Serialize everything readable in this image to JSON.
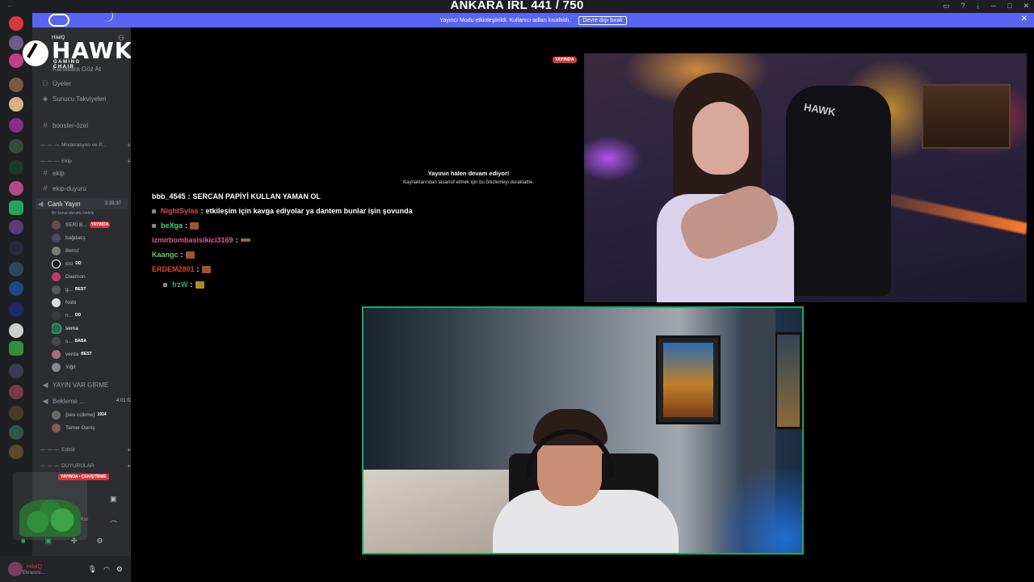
{
  "window": {
    "title": "ANKARA IRL 441 / 750"
  },
  "notice": {
    "text": "Yayıncı Modu etkinleştirildi. Kullanıcı adları kısaltıldı.",
    "button": "Devre dışı bırak"
  },
  "brand": {
    "word": "HAWK",
    "sub": "GAMING CHAIR"
  },
  "sidebar": {
    "server_name": "HilalQ",
    "items": [
      {
        "label": "Kanallara Göz At"
      },
      {
        "label": "Üyeler"
      },
      {
        "label": "Sunucu Takviyeleri"
      },
      {
        "label": "booster-özel"
      },
      {
        "label": "Moderasyon ve P..."
      },
      {
        "label": "Ekip"
      },
      {
        "label": "ekip"
      },
      {
        "label": "ekip-duyuru"
      },
      {
        "label": "Canlı Yayın"
      },
      {
        "label": "Bir kanal durumu belirle"
      },
      {
        "label": "YAYIN VAR GİRME"
      },
      {
        "label": "Bekleme ..."
      },
      {
        "label": "Editör"
      },
      {
        "label": "DUYURULAR"
      }
    ],
    "live_time": "3:35:37",
    "wait_time": "4:01:03",
    "live_badge": "YAYINDA",
    "voice_users": [
      {
        "name": "SERİ B...",
        "tag": "YAYINDA"
      },
      {
        "name": "bağdacş",
        "tag": ""
      },
      {
        "name": "Berru'",
        "tag": ""
      },
      {
        "name": "cici",
        "tag": "DD"
      },
      {
        "name": "Daemon",
        "tag": ""
      },
      {
        "name": "g...",
        "tag": "BEST"
      },
      {
        "name": "Nobi",
        "tag": ""
      },
      {
        "name": "n...",
        "tag": "DD"
      },
      {
        "name": "sema",
        "tag": ""
      },
      {
        "name": "s...",
        "tag": "BABA"
      },
      {
        "name": "verda",
        "tag": "BEST"
      },
      {
        "name": "Yiğit",
        "tag": ""
      }
    ],
    "wait_users": [
      {
        "name": "{ses ccikme}",
        "tag": "1934"
      },
      {
        "name": "Tamer Daniş",
        "tag": ""
      }
    ]
  },
  "voice_panel": {
    "badge": "YAYINDA • ÇEKİŞTİRME",
    "kur": "Kur"
  },
  "user_panel": {
    "name": "HilalQ",
    "status": "Ekranını..."
  },
  "stream": {
    "live_pill": "YAYINDA",
    "paused_title": "Yayının halen devam ediyor!",
    "paused_sub": "Kaynaklarından tasarruf etmek için bu önizlemeyi duraklattık.",
    "cam_brand": "HAWK"
  },
  "chat": [
    {
      "user": "bbb_4545",
      "sep": " : ",
      "text": "SERCAN PAPİYİ KULLAN YAMAN OL",
      "color": "#ffffff"
    },
    {
      "user": "NightSylas",
      "sep": " : ",
      "text": "etkileşim için kavga ediyolar ya dantem bunlar işin şovunda",
      "color": "#e0464a"
    },
    {
      "user": "beXga",
      "sep": " : ",
      "text": "",
      "color": "#3ed67a"
    },
    {
      "user": "izmirbombasisikici3169",
      "sep": " : ",
      "text": "",
      "color": "#e05a9a"
    },
    {
      "user": "Kaangc",
      "sep": " : ",
      "text": "",
      "color": "#5ed05e"
    },
    {
      "user": "ERDEM2801",
      "sep": " : ",
      "text": "",
      "color": "#e0462a"
    },
    {
      "user": "frzW",
      "sep": " : ",
      "text": "",
      "color": "#3aa860"
    }
  ],
  "colors": {
    "accent": "#5865f2",
    "live": "#da373c",
    "speaking": "#23a55a"
  }
}
